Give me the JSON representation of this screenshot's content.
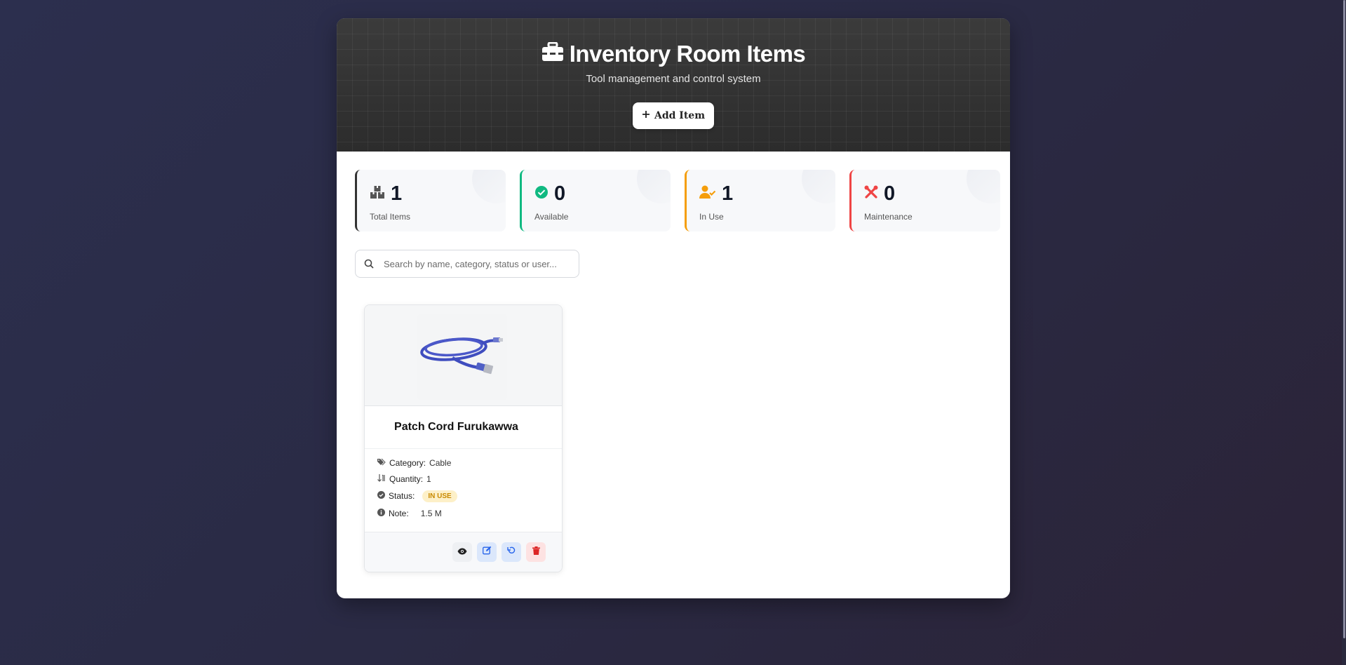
{
  "header": {
    "title": "Inventory Room Items",
    "subtitle": "Tool management and control system",
    "add_button_label": "Add Item"
  },
  "stats": [
    {
      "value": "1",
      "label": "Total Items",
      "accent": "#333333",
      "icon": "boxes-icon"
    },
    {
      "value": "0",
      "label": "Available",
      "accent": "#10b981",
      "icon": "check-circle-icon"
    },
    {
      "value": "1",
      "label": "In Use",
      "accent": "#f59e0b",
      "icon": "user-check-icon"
    },
    {
      "value": "0",
      "label": "Maintenance",
      "accent": "#ef4444",
      "icon": "tools-icon"
    }
  ],
  "search": {
    "placeholder": "Search by name, category, status or user...",
    "value": ""
  },
  "items": [
    {
      "name": "Patch Cord Furukawwa",
      "category_label": "Category:",
      "category": "Cable",
      "quantity_label": "Quantity:",
      "quantity": "1",
      "status_label": "Status:",
      "status": "IN USE",
      "note_label": "Note:",
      "note": "1.5 M",
      "image": "blue-patch-cord-cable"
    }
  ],
  "colors": {
    "in_use_badge_bg": "#fdf0c8",
    "in_use_badge_text": "#c98a00",
    "edit_button": "#2563eb",
    "delete_button": "#dc2626"
  }
}
